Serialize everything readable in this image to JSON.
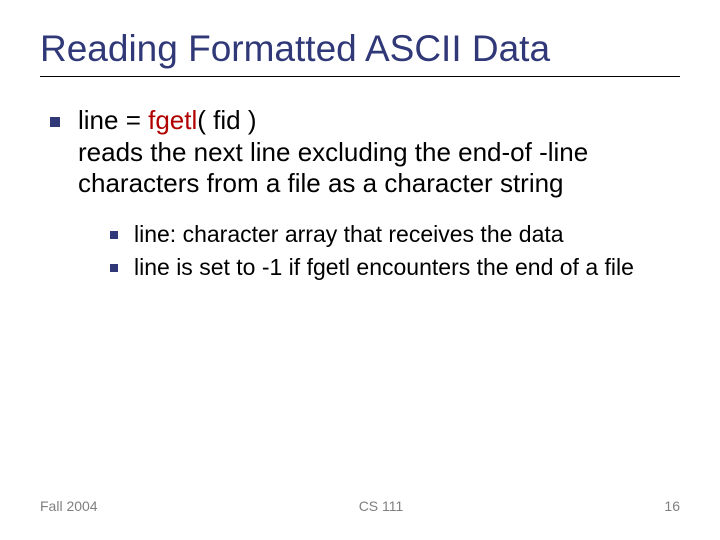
{
  "title": "Reading Formatted ASCII Data",
  "main": {
    "line_prefix": "line = ",
    "fn_name": "fgetl",
    "line_suffix": "( fid )",
    "desc": "reads the next line excluding the end-of -line characters from a file as a character string"
  },
  "sub": [
    "line: character array that receives the data",
    "line is set to -1 if fgetl encounters the end of a file"
  ],
  "footer": {
    "left": "Fall 2004",
    "center": "CS 111",
    "right": "16"
  }
}
